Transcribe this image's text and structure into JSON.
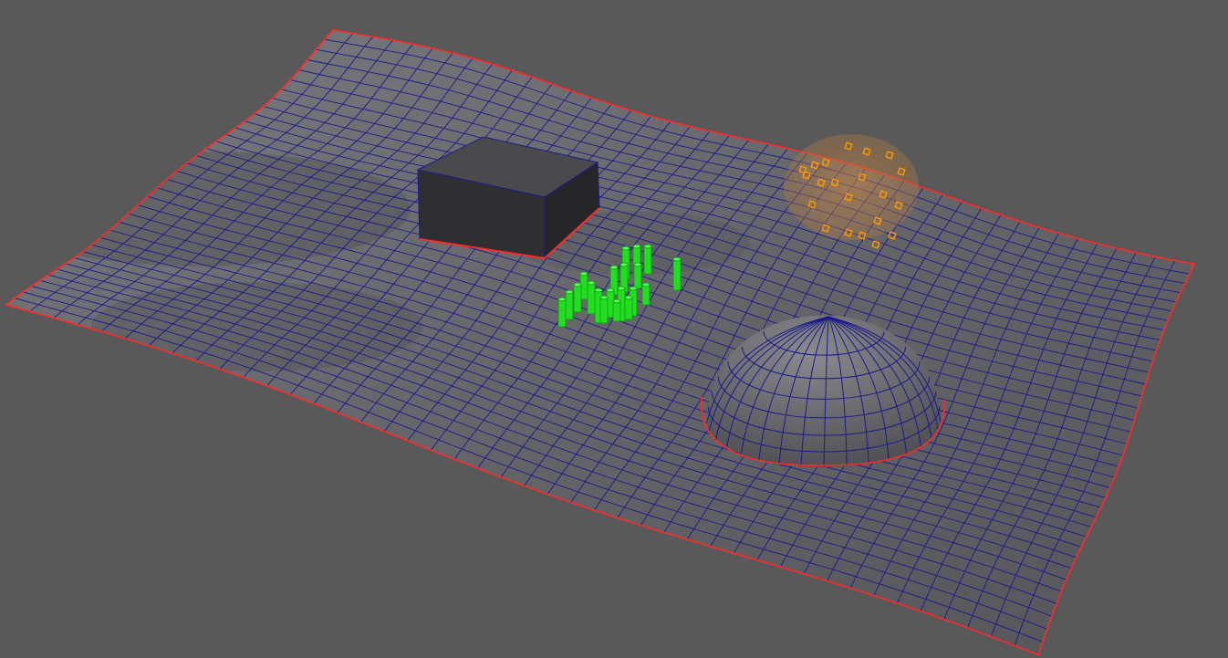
{
  "viewport": {
    "background_color": "#595959",
    "camera": "perspective",
    "shading": "smooth-shade-with-wireframe"
  },
  "colors": {
    "terrain_fill": "#6c6c70",
    "terrain_fill_dark": "#4a4a4e",
    "wireframe": "#1a1a8c",
    "border_highlight": "#ff2a2a",
    "box_front": "#2f2f31",
    "box_top": "#4a4a4c",
    "box_side": "#262628",
    "dome_fill": "#6a6a6e",
    "cylinders": "#22dd22",
    "selection_sphere": "#c98a4a",
    "selection_points": "#ff9a00"
  },
  "scene": {
    "objects": [
      {
        "name": "terrain",
        "type": "deformed-plane-mesh"
      },
      {
        "name": "box",
        "type": "cube-mesh"
      },
      {
        "name": "dome",
        "type": "half-sphere-mesh"
      },
      {
        "name": "cylinder-cluster",
        "type": "instanced-cylinders",
        "count": 22
      },
      {
        "name": "soft-selection-falloff",
        "type": "selection-highlight",
        "point_count": 18
      }
    ]
  }
}
